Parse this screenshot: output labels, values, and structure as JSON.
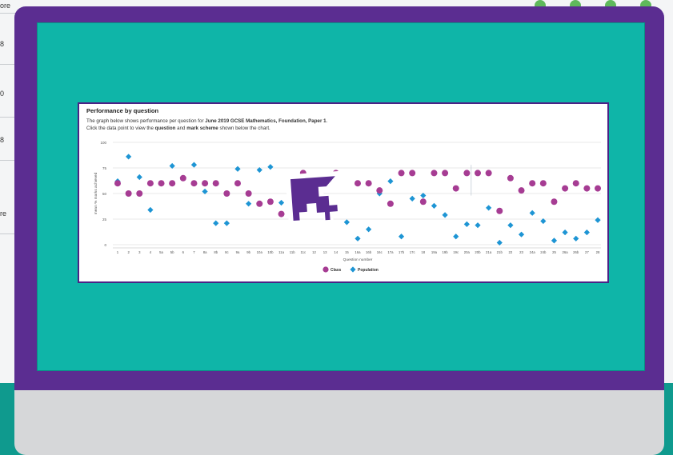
{
  "background": {
    "labels": [
      "ore",
      "8",
      "0",
      "8",
      "re"
    ]
  },
  "panel": {
    "title": "Performance by question",
    "desc_line1_a": "The graph below shows performance per question for ",
    "desc_line1_b": "June 2019 GCSE Mathematics, Foundation, Paper 1",
    "desc_line1_c": ".",
    "desc_line2_a": "Click the data point to view the ",
    "desc_line2_b": "question",
    "desc_line2_c": " and ",
    "desc_line2_d": "mark scheme",
    "desc_line2_e": " shown below the chart."
  },
  "colors": {
    "class": "#a63c93",
    "population": "#1e95d4",
    "monitor": "#5b2d91",
    "screen": "#0fb5a8"
  },
  "chart_data": {
    "type": "scatter",
    "xlabel": "Question number",
    "ylabel": "mean % marks achieved",
    "ylim": [
      0,
      100
    ],
    "yticks": [
      0,
      25,
      50,
      75,
      100
    ],
    "grid": true,
    "legend_position": "bottom-center",
    "categories": [
      "1",
      "2",
      "3",
      "4",
      "5a",
      "5b",
      "6",
      "7",
      "8a",
      "8b",
      "8c",
      "9a",
      "9b",
      "10a",
      "10b",
      "11a",
      "11b",
      "11c",
      "12",
      "13",
      "14",
      "15",
      "16a",
      "16b",
      "16c",
      "17a",
      "17b",
      "17c",
      "18",
      "19a",
      "19b",
      "19c",
      "20a",
      "20b",
      "21a",
      "21b",
      "22",
      "23",
      "24a",
      "24b",
      "25",
      "26a",
      "26b",
      "27",
      "28"
    ],
    "series": [
      {
        "name": "Class",
        "marker": "circle",
        "values": [
          60,
          50,
          50,
          60,
          60,
          60,
          65,
          60,
          60,
          60,
          50,
          60,
          50,
          40,
          42,
          30,
          60,
          70,
          60,
          60,
          70,
          null,
          60,
          60,
          53,
          40,
          70,
          70,
          42,
          70,
          70,
          55,
          70,
          70,
          70,
          33,
          65,
          53,
          60,
          60,
          42,
          55,
          60,
          55,
          55
        ]
      },
      {
        "name": "Population",
        "marker": "diamond",
        "values": [
          62,
          86,
          66,
          34,
          60,
          77,
          65,
          78,
          52,
          21,
          21,
          74,
          40,
          73,
          76,
          41,
          27,
          null,
          64,
          null,
          null,
          22,
          6,
          15,
          50,
          62,
          8,
          45,
          48,
          38,
          29,
          8,
          20,
          19,
          36,
          2,
          19,
          10,
          31,
          23,
          4,
          12,
          6,
          12,
          24
        ]
      }
    ]
  }
}
